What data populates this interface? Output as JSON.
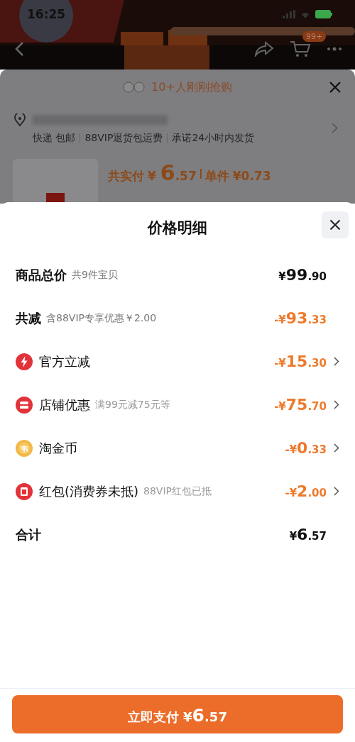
{
  "status_bar": {
    "time": "16:25"
  },
  "nav": {
    "cart_badge": "99+"
  },
  "sheet": {
    "popular": "10+人刚刚抢购",
    "tags": [
      "快递 包邮",
      "88VIP退货包运费",
      "承诺24小时内发货"
    ],
    "paid_label": "共实付",
    "paid_amount": "¥ 6.57",
    "unit_label": "单件",
    "unit_amount": "¥0.73"
  },
  "modal": {
    "title": "价格明细",
    "rows": [
      {
        "kind": "summary",
        "label": "商品总价",
        "note": "共9件宝贝",
        "amount": "¥99.90",
        "negative": false
      },
      {
        "kind": "summary",
        "label": "共减",
        "note": "含88VIP专享优惠￥2.00",
        "amount": "-¥93.33",
        "negative": true
      },
      {
        "kind": "detail",
        "label": "官方立减",
        "amount": "-¥15.30",
        "negative": true
      },
      {
        "kind": "detail",
        "label": "店铺优惠",
        "note": "满99元减75元等",
        "amount": "-¥75.70",
        "negative": true
      },
      {
        "kind": "detail",
        "label": "淘金币",
        "amount": "-¥0.33",
        "negative": true
      },
      {
        "kind": "detail",
        "label": "红包(消费券未抵)",
        "note": "88VIP红包已抵",
        "amount": "-¥2.00",
        "negative": true
      },
      {
        "kind": "summary",
        "label": "合计",
        "amount": "¥6.57",
        "negative": false
      }
    ],
    "pay_label": "立即支付",
    "pay_amount": "¥6.57"
  }
}
